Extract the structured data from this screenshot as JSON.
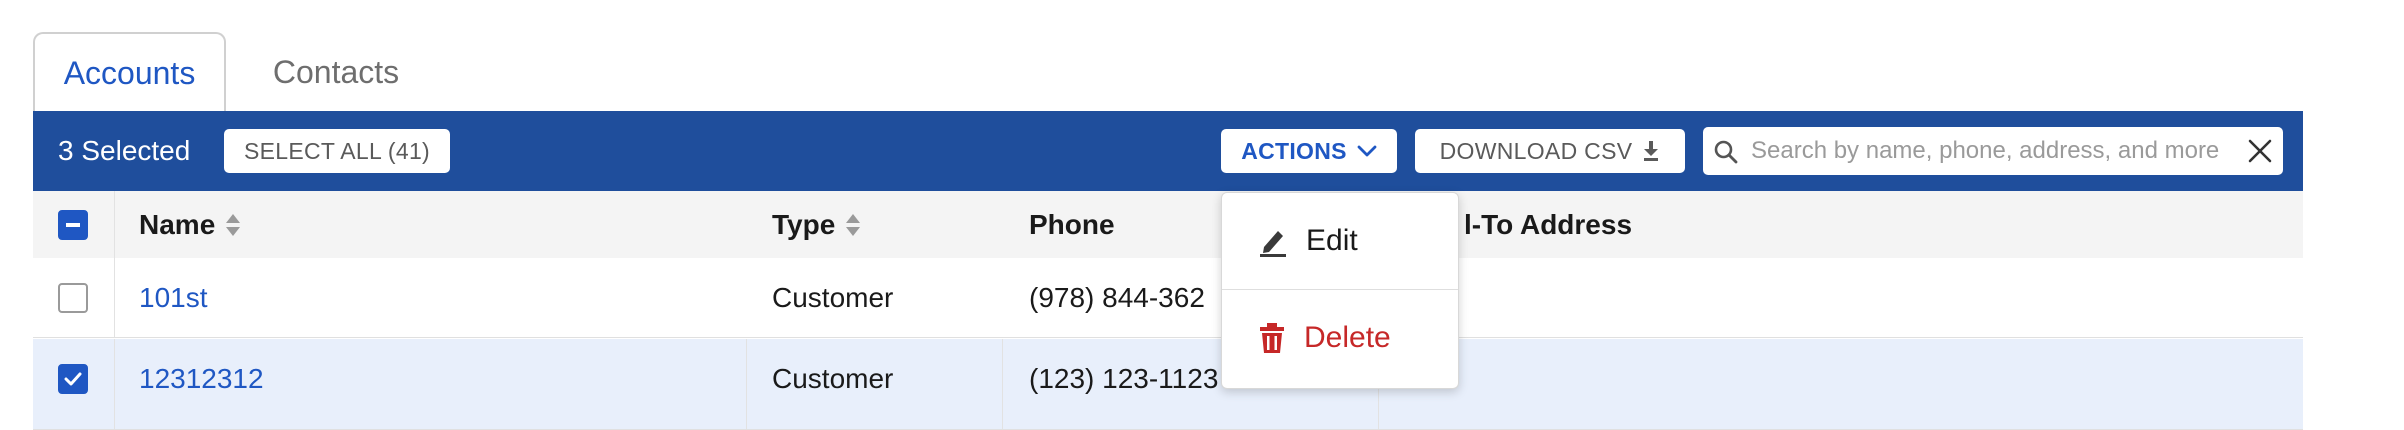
{
  "tabs": [
    {
      "label": "Accounts",
      "active": true
    },
    {
      "label": "Contacts",
      "active": false
    }
  ],
  "toolbar": {
    "selected_label": "3 Selected",
    "select_all_label": "SELECT ALL (41)",
    "actions_label": "ACTIONS",
    "download_label": "DOWNLOAD CSV",
    "search_placeholder": "Search by name, phone, address, and more",
    "search_value": ""
  },
  "table": {
    "headers": {
      "name": "Name",
      "type": "Type",
      "phone": "Phone",
      "address": "Bill-To Address"
    },
    "address_visible": "l-To Address",
    "rows": [
      {
        "checked": false,
        "name": "101st",
        "type": "Customer",
        "phone_visible": "(978) 844-362"
      },
      {
        "checked": true,
        "name": "12312312",
        "type": "Customer",
        "phone_visible": "(123) 123-1123"
      }
    ]
  },
  "actions_menu": {
    "items": [
      {
        "label": "Edit",
        "icon": "pencil-icon"
      },
      {
        "label": "Delete",
        "icon": "trash-icon"
      }
    ]
  },
  "colors": {
    "accent": "#1f57c3",
    "bar": "#1f4e9c",
    "danger": "#c62828",
    "selected_row": "#e8effb"
  }
}
